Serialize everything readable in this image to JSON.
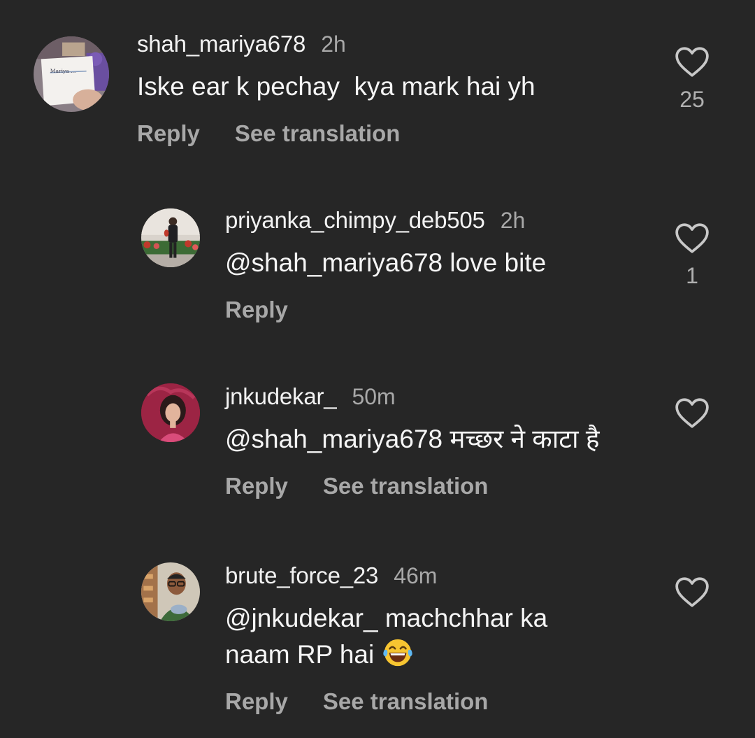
{
  "comments": [
    {
      "username": "shah_mariya678",
      "time": "2h",
      "text": "Iske ear k pechay  kya mark hai yh",
      "reply_label": "Reply",
      "translate_label": "See translation",
      "like_count": "25",
      "avatar": "profile-photo-handwritten-note-icon"
    },
    {
      "username": "priyanka_chimpy_deb505",
      "time": "2h",
      "text": "@shah_mariya678 love bite",
      "reply_label": "Reply",
      "like_count": "1",
      "avatar": "profile-photo-woman-standing-icon"
    },
    {
      "username": "jnkudekar_",
      "time": "50m",
      "text": "@shah_mariya678 मच्छर ने काटा है",
      "reply_label": "Reply",
      "translate_label": "See translation",
      "avatar": "profile-photo-woman-portrait-icon"
    },
    {
      "username": "brute_force_23",
      "time": "46m",
      "text_line1": "@jnkudekar_ machchhar ka",
      "text_line2": "naam RP hai",
      "emoji": "face-with-tears-of-joy-emoji",
      "reply_label": "Reply",
      "translate_label": "See translation",
      "avatar": "profile-photo-man-glasses-icon"
    }
  ],
  "colors": {
    "background": "#262626",
    "primary_text": "#f5f5f5",
    "secondary_text": "#a8a8a8"
  }
}
